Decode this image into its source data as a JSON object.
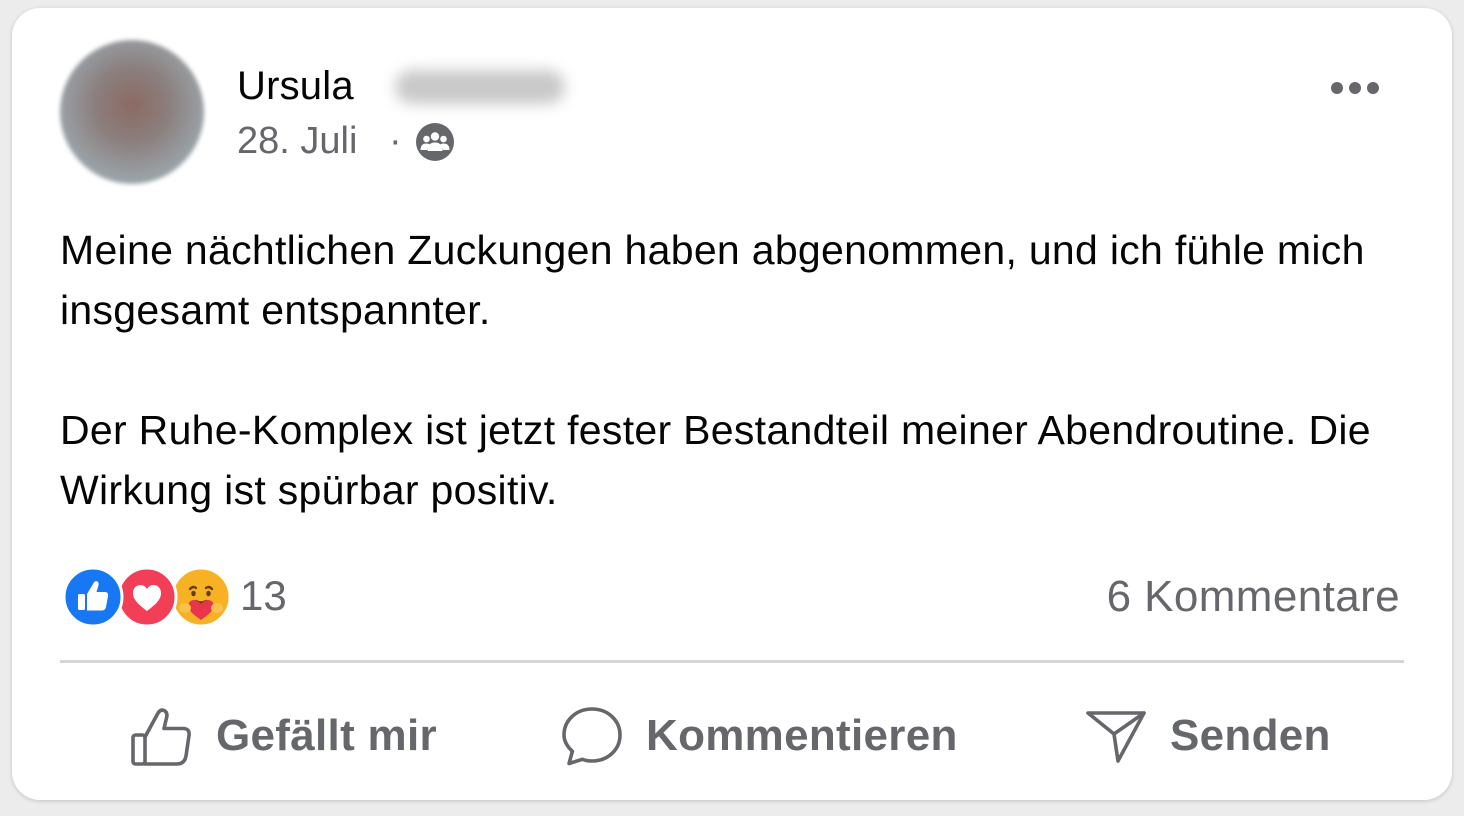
{
  "post": {
    "author_first_name": "Ursula",
    "date": "28. Juli",
    "separator": "·",
    "audience_icon": "friends-icon",
    "menu_icon": "more-options-icon",
    "paragraphs": [
      "Meine nächtlichen Zuckungen haben abgenommen, und ich fühle mich insgesamt entspannter.",
      "Der Ruhe-Komplex ist jetzt fester Bestandteil meiner Abendroutine. Die Wirkung ist spürbar positiv."
    ]
  },
  "engagement": {
    "reactions": [
      "like-reaction-icon",
      "love-reaction-icon",
      "care-reaction-icon"
    ],
    "reaction_count": "13",
    "comment_count_label": "6 Kommentare"
  },
  "actions": {
    "like_label": "Gefällt mir",
    "comment_label": "Kommentieren",
    "send_label": "Senden"
  },
  "colors": {
    "text_primary": "#050505",
    "text_secondary": "#65676b",
    "like_blue": "#1877f2",
    "love_red": "#f33e58",
    "care_yellow": "#f7b125",
    "divider": "#d4d6da"
  }
}
